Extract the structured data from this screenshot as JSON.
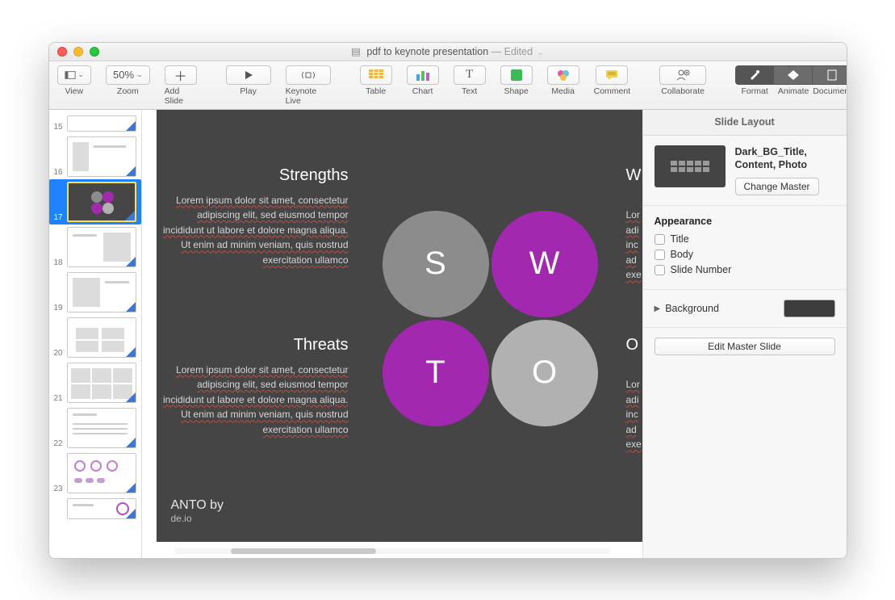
{
  "window": {
    "title": "pdf to keynote presentation",
    "edited": "— Edited",
    "chevron": "⌄"
  },
  "toolbar": {
    "view": "View",
    "zoom_label": "Zoom",
    "zoom_value": "50%",
    "add_slide": "Add Slide",
    "play": "Play",
    "keynote_live": "Keynote Live",
    "table": "Table",
    "chart": "Chart",
    "text": "Text",
    "shape": "Shape",
    "media": "Media",
    "comment": "Comment",
    "collaborate": "Collaborate",
    "format": "Format",
    "animate": "Animate",
    "document": "Document"
  },
  "navigator": {
    "slides": [
      {
        "num": "15"
      },
      {
        "num": "16"
      },
      {
        "num": "17",
        "selected": true
      },
      {
        "num": "18"
      },
      {
        "num": "19"
      },
      {
        "num": "20"
      },
      {
        "num": "21"
      },
      {
        "num": "22"
      },
      {
        "num": "23"
      }
    ]
  },
  "slide": {
    "s_title": "Strengths",
    "t_title": "Threats",
    "w_title": "W",
    "o_title": "O",
    "body": "Lorem ipsum dolor sit amet, consectetur adipiscing elit, sed eiusmod tempor incididunt ut labore et dolore magna aliqua. Ut enim ad minim veniam, quis nostrud exercitation ullamco",
    "body_right": "Lor\nadi\ninc\nad\nexe",
    "circle_s": "S",
    "circle_w": "W",
    "circle_t": "T",
    "circle_o": "O",
    "footer1": "ANTO by",
    "footer2": "de.io"
  },
  "inspector": {
    "tab": "Slide Layout",
    "master_name": "Dark_BG_Title, Content, Photo",
    "change_master": "Change Master",
    "appearance": "Appearance",
    "chk_title": "Title",
    "chk_body": "Body",
    "chk_slidenum": "Slide Number",
    "background": "Background",
    "edit_master": "Edit Master Slide",
    "bg_color": "#3d3d3d"
  }
}
